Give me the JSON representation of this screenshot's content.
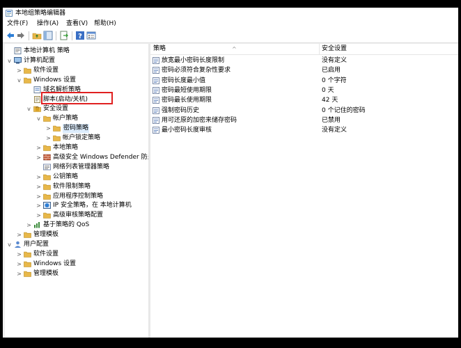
{
  "window": {
    "title": "本地组策略编辑器"
  },
  "menu": [
    "文件(F)",
    "操作(A)",
    "查看(V)",
    "帮助(H)"
  ],
  "toolbar": {
    "icons": [
      "back-arrow-icon",
      "forward-arrow-icon",
      "up-folder-icon",
      "show-hide-tree-icon",
      "export-list-icon",
      "help-icon",
      "properties-icon"
    ]
  },
  "tree": [
    {
      "label": "本地计算机 策略",
      "icon": "computer-policy-icon"
    },
    {
      "label": "计算机配置",
      "icon": "computer-icon"
    },
    {
      "label": "软件设置",
      "icon": "folder-icon"
    },
    {
      "label": "Windows 设置",
      "icon": "folder-icon"
    },
    {
      "label": "域名解析策略",
      "icon": "policy-icon"
    },
    {
      "label": "脚本(启动/关机)",
      "icon": "script-icon"
    },
    {
      "label": "安全设置",
      "icon": "security-icon"
    },
    {
      "label": "帐户策略",
      "icon": "folder-icon"
    },
    {
      "label": "密码策略",
      "icon": "folder-icon"
    },
    {
      "label": "帐户锁定策略",
      "icon": "folder-icon"
    },
    {
      "label": "本地策略",
      "icon": "folder-icon"
    },
    {
      "label": "高级安全 Windows Defender 防火",
      "icon": "firewall-icon"
    },
    {
      "label": "网络列表管理器策略",
      "icon": "network-list-icon"
    },
    {
      "label": "公钥策略",
      "icon": "folder-icon"
    },
    {
      "label": "软件限制策略",
      "icon": "folder-icon"
    },
    {
      "label": "应用程序控制策略",
      "icon": "folder-icon"
    },
    {
      "label": "IP 安全策略，在 本地计算机",
      "icon": "ip-security-icon"
    },
    {
      "label": "高级审核策略配置",
      "icon": "folder-icon"
    },
    {
      "label": "基于策略的 QoS",
      "icon": "qos-chart-icon"
    },
    {
      "label": "管理模板",
      "icon": "folder-icon"
    },
    {
      "label": "用户配置",
      "icon": "user-icon"
    },
    {
      "label": "软件设置",
      "icon": "folder-icon"
    },
    {
      "label": "Windows 设置",
      "icon": "folder-icon"
    },
    {
      "label": "管理模板",
      "icon": "folder-icon"
    }
  ],
  "list": {
    "columns": [
      "策略",
      "安全设置"
    ],
    "rows": [
      {
        "policy": "放宽最小密码长度限制",
        "setting": "没有定义"
      },
      {
        "policy": "密码必须符合复杂性要求",
        "setting": "已启用"
      },
      {
        "policy": "密码长度最小值",
        "setting": "0 个字符"
      },
      {
        "policy": "密码最短使用期限",
        "setting": "0 天"
      },
      {
        "policy": "密码最长使用期限",
        "setting": "42 天"
      },
      {
        "policy": "强制密码历史",
        "setting": "0 个记住的密码"
      },
      {
        "policy": "用可还原的加密来储存密码",
        "setting": "已禁用"
      },
      {
        "policy": "最小密码长度审核",
        "setting": "没有定义"
      }
    ]
  },
  "colors": {
    "folder": "#e8b84a",
    "highlight": "#e02020",
    "accent": "#1e6fd0"
  }
}
